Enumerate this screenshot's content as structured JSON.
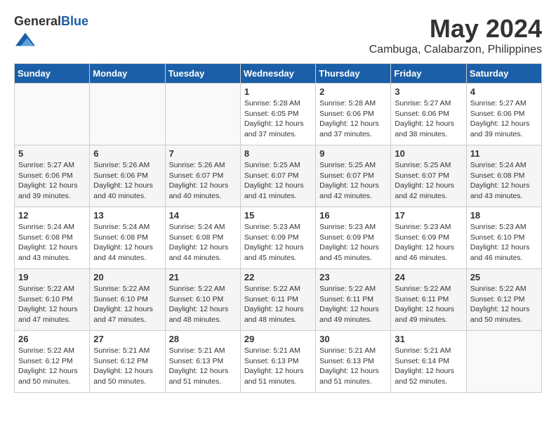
{
  "header": {
    "logo_general": "General",
    "logo_blue": "Blue",
    "month_title": "May 2024",
    "location": "Cambuga, Calabarzon, Philippines"
  },
  "weekdays": [
    "Sunday",
    "Monday",
    "Tuesday",
    "Wednesday",
    "Thursday",
    "Friday",
    "Saturday"
  ],
  "weeks": [
    [
      {
        "day": "",
        "text": ""
      },
      {
        "day": "",
        "text": ""
      },
      {
        "day": "",
        "text": ""
      },
      {
        "day": "1",
        "text": "Sunrise: 5:28 AM\nSunset: 6:05 PM\nDaylight: 12 hours and 37 minutes."
      },
      {
        "day": "2",
        "text": "Sunrise: 5:28 AM\nSunset: 6:06 PM\nDaylight: 12 hours and 37 minutes."
      },
      {
        "day": "3",
        "text": "Sunrise: 5:27 AM\nSunset: 6:06 PM\nDaylight: 12 hours and 38 minutes."
      },
      {
        "day": "4",
        "text": "Sunrise: 5:27 AM\nSunset: 6:06 PM\nDaylight: 12 hours and 39 minutes."
      }
    ],
    [
      {
        "day": "5",
        "text": "Sunrise: 5:27 AM\nSunset: 6:06 PM\nDaylight: 12 hours and 39 minutes."
      },
      {
        "day": "6",
        "text": "Sunrise: 5:26 AM\nSunset: 6:06 PM\nDaylight: 12 hours and 40 minutes."
      },
      {
        "day": "7",
        "text": "Sunrise: 5:26 AM\nSunset: 6:07 PM\nDaylight: 12 hours and 40 minutes."
      },
      {
        "day": "8",
        "text": "Sunrise: 5:25 AM\nSunset: 6:07 PM\nDaylight: 12 hours and 41 minutes."
      },
      {
        "day": "9",
        "text": "Sunrise: 5:25 AM\nSunset: 6:07 PM\nDaylight: 12 hours and 42 minutes."
      },
      {
        "day": "10",
        "text": "Sunrise: 5:25 AM\nSunset: 6:07 PM\nDaylight: 12 hours and 42 minutes."
      },
      {
        "day": "11",
        "text": "Sunrise: 5:24 AM\nSunset: 6:08 PM\nDaylight: 12 hours and 43 minutes."
      }
    ],
    [
      {
        "day": "12",
        "text": "Sunrise: 5:24 AM\nSunset: 6:08 PM\nDaylight: 12 hours and 43 minutes."
      },
      {
        "day": "13",
        "text": "Sunrise: 5:24 AM\nSunset: 6:08 PM\nDaylight: 12 hours and 44 minutes."
      },
      {
        "day": "14",
        "text": "Sunrise: 5:24 AM\nSunset: 6:08 PM\nDaylight: 12 hours and 44 minutes."
      },
      {
        "day": "15",
        "text": "Sunrise: 5:23 AM\nSunset: 6:09 PM\nDaylight: 12 hours and 45 minutes."
      },
      {
        "day": "16",
        "text": "Sunrise: 5:23 AM\nSunset: 6:09 PM\nDaylight: 12 hours and 45 minutes."
      },
      {
        "day": "17",
        "text": "Sunrise: 5:23 AM\nSunset: 6:09 PM\nDaylight: 12 hours and 46 minutes."
      },
      {
        "day": "18",
        "text": "Sunrise: 5:23 AM\nSunset: 6:10 PM\nDaylight: 12 hours and 46 minutes."
      }
    ],
    [
      {
        "day": "19",
        "text": "Sunrise: 5:22 AM\nSunset: 6:10 PM\nDaylight: 12 hours and 47 minutes."
      },
      {
        "day": "20",
        "text": "Sunrise: 5:22 AM\nSunset: 6:10 PM\nDaylight: 12 hours and 47 minutes."
      },
      {
        "day": "21",
        "text": "Sunrise: 5:22 AM\nSunset: 6:10 PM\nDaylight: 12 hours and 48 minutes."
      },
      {
        "day": "22",
        "text": "Sunrise: 5:22 AM\nSunset: 6:11 PM\nDaylight: 12 hours and 48 minutes."
      },
      {
        "day": "23",
        "text": "Sunrise: 5:22 AM\nSunset: 6:11 PM\nDaylight: 12 hours and 49 minutes."
      },
      {
        "day": "24",
        "text": "Sunrise: 5:22 AM\nSunset: 6:11 PM\nDaylight: 12 hours and 49 minutes."
      },
      {
        "day": "25",
        "text": "Sunrise: 5:22 AM\nSunset: 6:12 PM\nDaylight: 12 hours and 50 minutes."
      }
    ],
    [
      {
        "day": "26",
        "text": "Sunrise: 5:22 AM\nSunset: 6:12 PM\nDaylight: 12 hours and 50 minutes."
      },
      {
        "day": "27",
        "text": "Sunrise: 5:21 AM\nSunset: 6:12 PM\nDaylight: 12 hours and 50 minutes."
      },
      {
        "day": "28",
        "text": "Sunrise: 5:21 AM\nSunset: 6:13 PM\nDaylight: 12 hours and 51 minutes."
      },
      {
        "day": "29",
        "text": "Sunrise: 5:21 AM\nSunset: 6:13 PM\nDaylight: 12 hours and 51 minutes."
      },
      {
        "day": "30",
        "text": "Sunrise: 5:21 AM\nSunset: 6:13 PM\nDaylight: 12 hours and 51 minutes."
      },
      {
        "day": "31",
        "text": "Sunrise: 5:21 AM\nSunset: 6:14 PM\nDaylight: 12 hours and 52 minutes."
      },
      {
        "day": "",
        "text": ""
      }
    ]
  ]
}
